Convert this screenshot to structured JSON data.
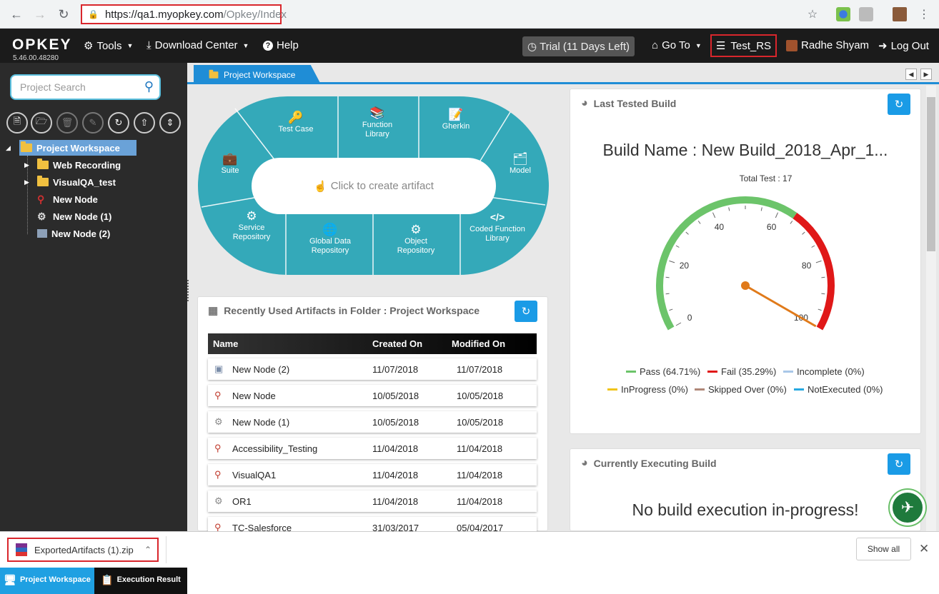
{
  "browser": {
    "url_host": "https://qa1.myopkey.com",
    "url_path": "/Opkey/Index"
  },
  "header": {
    "logo": "OPKEY",
    "version": "5.46.00.48280",
    "tools": "Tools",
    "download_center": "Download Center",
    "help": "Help",
    "trial": "Trial (11 Days Left)",
    "goto": "Go To",
    "project": "Test_RS",
    "user": "Radhe Shyam",
    "logout": "Log Out"
  },
  "sidebar": {
    "search_placeholder": "Project Search",
    "tree": {
      "root": "Project Workspace",
      "items": [
        "Web Recording",
        "VisualQA_test",
        "New Node",
        "New Node (1)",
        "New Node (2)"
      ]
    },
    "tab_workspace": "Project Workspace",
    "tab_execution": "Execution Result"
  },
  "workspace_tab": "Project Workspace",
  "wheel": {
    "hub": "Click to create artifact",
    "test_case": "Test Case",
    "function_library": [
      "Function",
      "Library"
    ],
    "gherkin": "Gherkin",
    "suite": "Suite",
    "model": "Model",
    "service_repository": [
      "Service",
      "Repository"
    ],
    "global_data_repository": [
      "Global Data",
      "Repository"
    ],
    "object_repository": [
      "Object",
      "Repository"
    ],
    "coded_function_library": [
      "Coded Function",
      "Library"
    ]
  },
  "recent": {
    "title": "Recently Used Artifacts in Folder : Project Workspace",
    "columns": [
      "Name",
      "Created On",
      "Modified On"
    ],
    "rows": [
      {
        "icon": "image-node-icon",
        "name": "New Node (2)",
        "created": "11/07/2018",
        "modified": "11/07/2018"
      },
      {
        "icon": "key-icon",
        "name": "New Node",
        "created": "10/05/2018",
        "modified": "10/05/2018"
      },
      {
        "icon": "gear-icon",
        "name": "New Node (1)",
        "created": "10/05/2018",
        "modified": "10/05/2018"
      },
      {
        "icon": "key-icon",
        "name": "Accessibility_Testing",
        "created": "11/04/2018",
        "modified": "11/04/2018"
      },
      {
        "icon": "key-icon",
        "name": "VisualQA1",
        "created": "11/04/2018",
        "modified": "11/04/2018"
      },
      {
        "icon": "gear-icon",
        "name": "OR1",
        "created": "11/04/2018",
        "modified": "11/04/2018"
      },
      {
        "icon": "key-icon",
        "name": "TC-Salesforce",
        "created": "31/03/2017",
        "modified": "05/04/2017"
      }
    ]
  },
  "last_build": {
    "title": "Last Tested Build",
    "build_name": "Build Name : New Build_2018_Apr_1...",
    "total": "Total Test : 17",
    "gauge_ticks": [
      "0",
      "20",
      "40",
      "60",
      "80",
      "100"
    ],
    "needle_value": 100,
    "pass_fraction": 0.6471,
    "legend": [
      {
        "label": "Pass (64.71%)",
        "color": "#6cc46a"
      },
      {
        "label": "Fail (35.29%)",
        "color": "#e01818"
      },
      {
        "label": "Incomplete (0%)",
        "color": "#a9c7e8"
      },
      {
        "label": "InProgress (0%)",
        "color": "#f0c419"
      },
      {
        "label": "Skipped Over (0%)",
        "color": "#b08878"
      },
      {
        "label": "NotExecuted (0%)",
        "color": "#27a9e1"
      }
    ]
  },
  "current_build": {
    "title": "Currently Executing Build",
    "message": "No build execution in-progress!"
  },
  "download": {
    "file": "ExportedArtifacts (1).zip",
    "show_all": "Show all"
  },
  "colors": {
    "wheel": "#34a9b9",
    "accent": "#1a9be6",
    "highlight_border": "#d9262c"
  }
}
